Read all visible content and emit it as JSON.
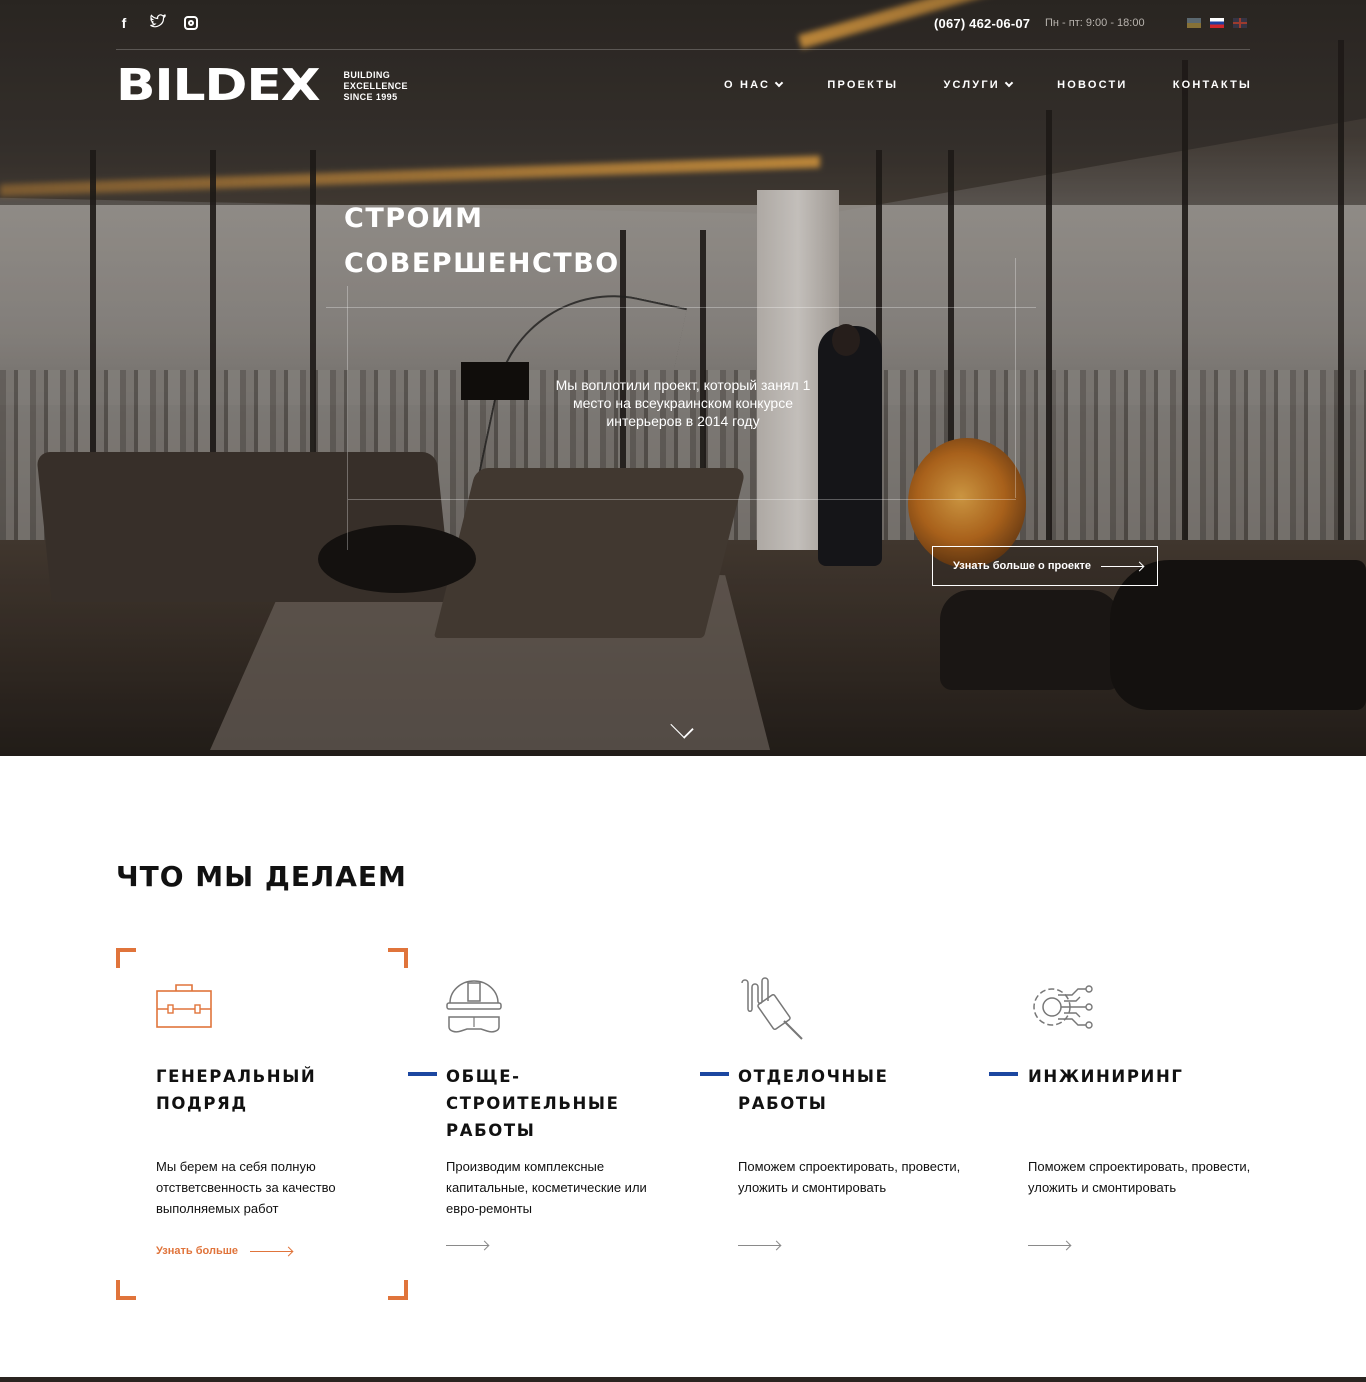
{
  "topbar": {
    "social": [
      "facebook-icon",
      "twitter-icon",
      "instagram-icon"
    ],
    "phone": "(067) 462-06-07",
    "hours": "Пн - пт: 9:00 - 18:00",
    "languages": [
      "ua",
      "ru",
      "en"
    ],
    "active_language": "ru"
  },
  "brand": {
    "logo": "BILDEX",
    "tagline_1": "BUILDING",
    "tagline_2": "EXCELLENCE",
    "tagline_3": "SINCE 1995"
  },
  "nav": {
    "items": [
      {
        "label": "О НАС",
        "dropdown": true
      },
      {
        "label": "ПРОЕКТЫ",
        "dropdown": false
      },
      {
        "label": "УСЛУГИ",
        "dropdown": true
      },
      {
        "label": "НОВОСТИ",
        "dropdown": false
      },
      {
        "label": "КОНТАКТЫ",
        "dropdown": false
      }
    ]
  },
  "hero": {
    "title_line1": "СТРОИМ",
    "title_line2": "СОВЕРШЕНСТВО",
    "description": "Мы воплотили проект, который занял 1 место на всеукраинском конкурсе интерьеров в 2014 году",
    "button_label": "Узнать больше о проекте"
  },
  "services": {
    "title": "ЧТО МЫ ДЕЛАЕМ",
    "cards": [
      {
        "icon": "briefcase-icon",
        "title": "ГЕНЕРАЛЬНЫЙ ПОДРЯД",
        "text": "Мы берем на себя полную отстветсвенность за качество выполняемых работ",
        "link": "Узнать больше",
        "active": true
      },
      {
        "icon": "hardhat-goggles-icon",
        "title": "ОБЩЕ- СТРОИТЕЛЬНЫЕ РАБОТЫ",
        "text": "Производим комплексные капитальные, косметические или евро-ремонты",
        "link": "",
        "active": false
      },
      {
        "icon": "paint-roller-icon",
        "title": "ОТДЕЛОЧНЫЕ РАБОТЫ",
        "text": "Поможем спроектировать, провести, уложить и смонтировать",
        "link": "",
        "active": false
      },
      {
        "icon": "gear-circuit-icon",
        "title": "ИНЖИНИРИНГ",
        "text": "Поможем спроектировать, провести, уложить и смонтировать",
        "link": "",
        "active": false
      }
    ]
  },
  "colors": {
    "accent": "#e0743b",
    "secondary": "#1c47a0",
    "text": "#111111"
  }
}
